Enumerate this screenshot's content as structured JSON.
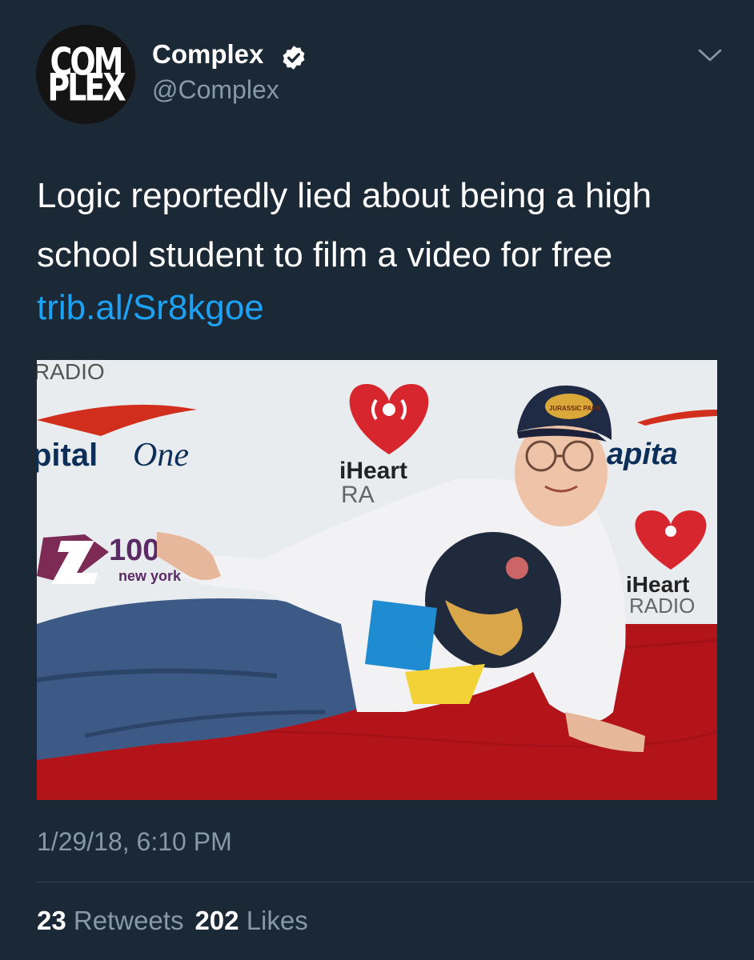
{
  "tweet": {
    "avatar": {
      "line1": "COM",
      "line2": "PLEX"
    },
    "author": {
      "display_name": "Complex",
      "handle": "@Complex",
      "verified_icon": "verified-badge-icon"
    },
    "menu_icon": "chevron-down-icon",
    "text": "Logic reportedly lied about being a high school student to film a video for free",
    "link": "trib.al/Sr8kgoe",
    "media": {
      "backdrop_texts": {
        "radio_top": "RADIO",
        "capital_one_left": "pital",
        "capital_one_script": "One",
        "iheart_center": "iHeart",
        "radio_center_partial": "RA",
        "capital_right": "apita",
        "z100_number": "100",
        "z100_city": "new york",
        "iheart_right": "iHeart",
        "radio_right": "RADIO",
        "cap_patch": "JURASSIC PARK"
      }
    },
    "timestamp": "1/29/18, 6:10 PM",
    "stats": {
      "retweets_count": "23",
      "retweets_label": "Retweets",
      "likes_count": "202",
      "likes_label": "Likes"
    },
    "colors": {
      "background": "#1b2836",
      "link": "#1da1f2",
      "secondary_text": "#8899a6",
      "verified_badge": "#ffffff"
    }
  }
}
